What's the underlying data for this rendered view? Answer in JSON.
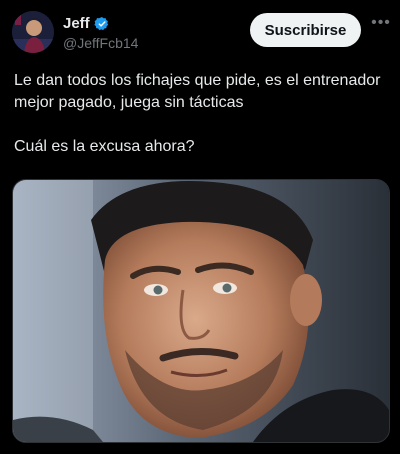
{
  "user": {
    "display_name": "Jeff",
    "handle": "@JeffFcb14"
  },
  "actions": {
    "subscribe_label": "Suscribirse",
    "more_label": "•••"
  },
  "tweet": {
    "line1": "Le dan todos los fichajes que pide, es el entrenador mejor pagado, juega sin tácticas",
    "line2": "Cuál es la excusa ahora?"
  },
  "colors": {
    "background": "#000000",
    "text": "#e7e9ea",
    "muted": "#71767b",
    "verified": "#1d9bf0",
    "button_bg": "#eff3f4"
  },
  "icons": {
    "verified": "verified-badge-icon",
    "more": "more-options-icon"
  }
}
